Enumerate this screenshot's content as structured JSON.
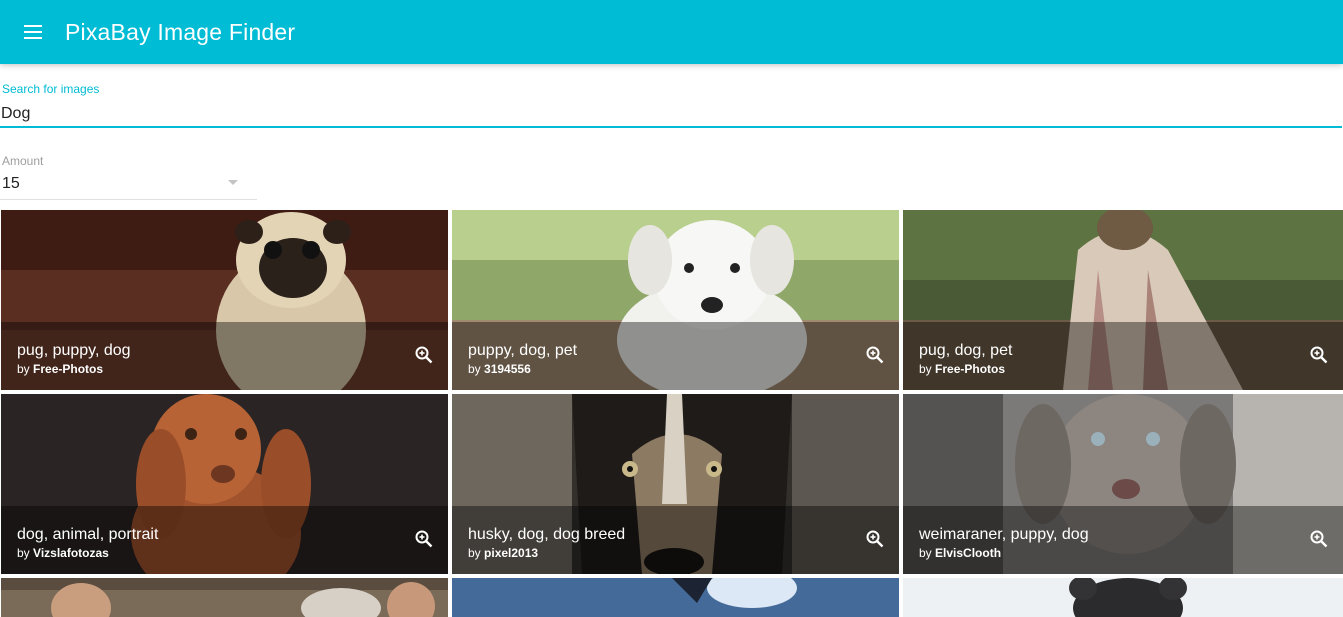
{
  "app": {
    "title": "PixaBay Image Finder",
    "accent": "#00bcd4"
  },
  "search": {
    "label": "Search for images",
    "value": "Dog"
  },
  "amount": {
    "label": "Amount",
    "value": "15"
  },
  "results": [
    {
      "title": "pug, puppy, dog",
      "by": "by",
      "author": "Free-Photos"
    },
    {
      "title": "puppy, dog, pet",
      "by": "by",
      "author": "3194556"
    },
    {
      "title": "pug, dog, pet",
      "by": "by",
      "author": "Free-Photos"
    },
    {
      "title": "dog, animal, portrait",
      "by": "by",
      "author": "Vizslafotozas"
    },
    {
      "title": "husky, dog, dog breed",
      "by": "by",
      "author": "pixel2013"
    },
    {
      "title": "weimaraner, puppy, dog",
      "by": "by",
      "author": "ElvisClooth"
    }
  ]
}
